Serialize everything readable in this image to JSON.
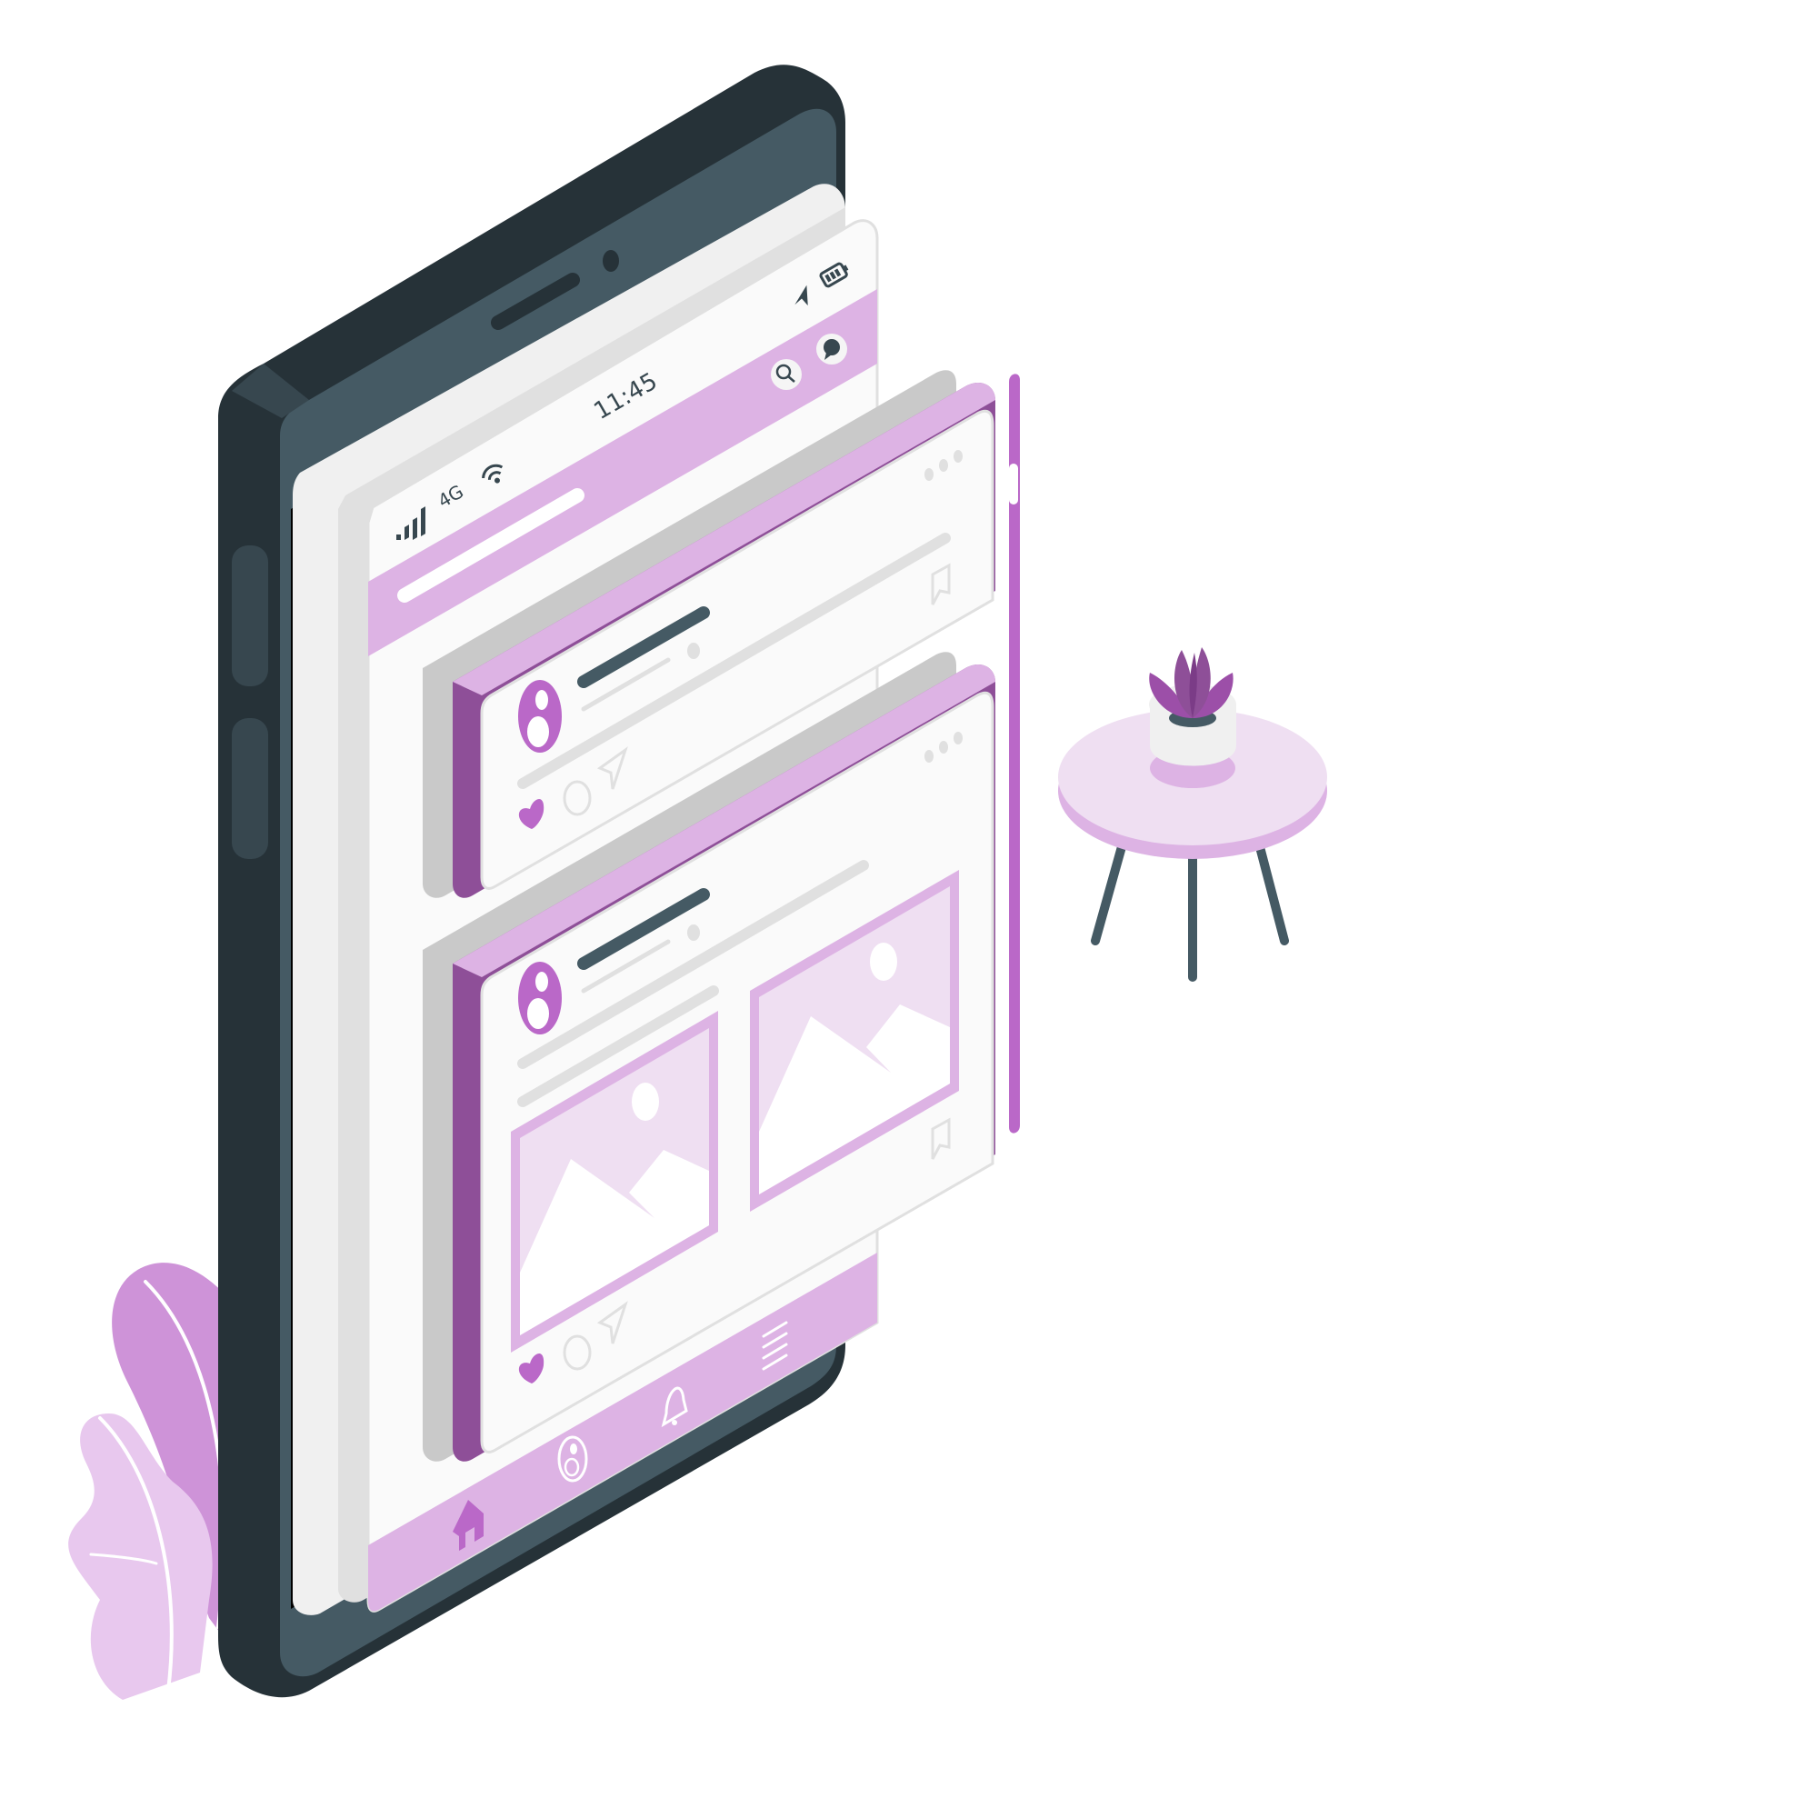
{
  "illustration": {
    "type": "isometric-phone-social-feed"
  },
  "status_bar": {
    "signal_label": "4G",
    "time": "11:45"
  },
  "icons": {
    "signal": "signal-bars-icon",
    "wifi": "wifi-icon",
    "location": "location-arrow-icon",
    "battery": "battery-icon",
    "search": "search-icon",
    "messages": "chat-bubble-icon",
    "more": "more-dots-icon",
    "bookmark": "bookmark-icon",
    "avatar": "user-avatar-icon",
    "like": "heart-icon",
    "comment": "comment-icon",
    "share": "send-icon",
    "image": "image-placeholder-icon",
    "home": "home-icon",
    "profile": "profile-icon",
    "notifications": "bell-icon",
    "menu": "hamburger-menu-icon",
    "plant": "potted-plant-icon",
    "table": "side-table-icon"
  },
  "colors": {
    "phone_dark": "#263238",
    "phone_body": "#455a64",
    "screen": "#f5f5f5",
    "accent": "#ba68c8",
    "accent_dark": "#8e4f98",
    "accent_light": "#ddb3e4",
    "accent_pale": "#efdff2",
    "grey_line": "#e0e0e0"
  }
}
